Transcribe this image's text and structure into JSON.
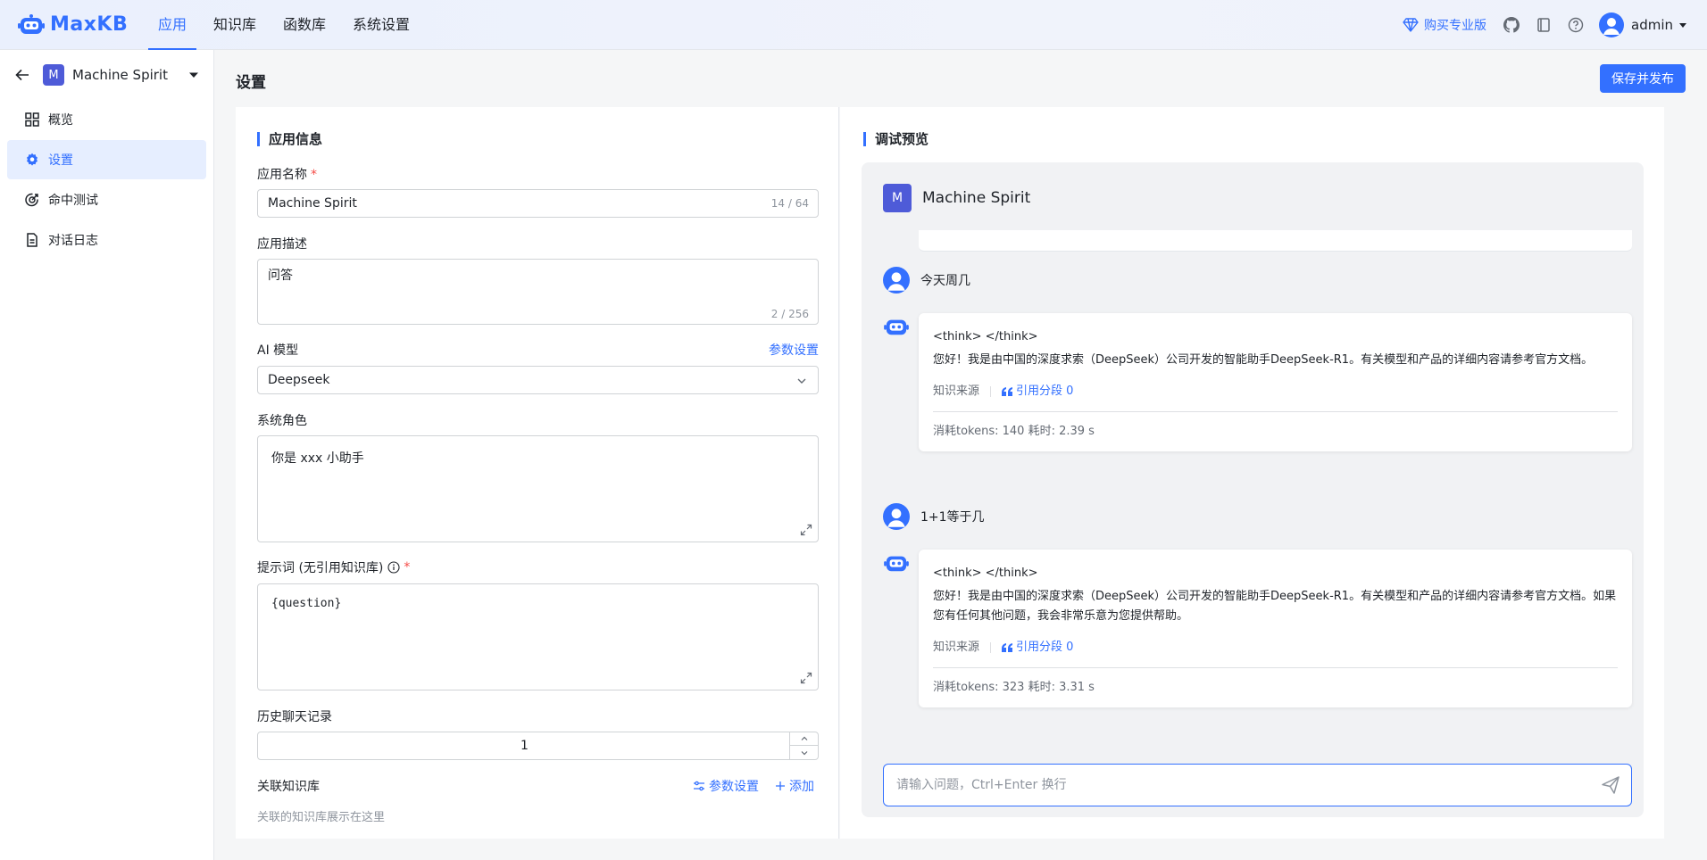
{
  "topbar": {
    "brand": "MaxKB",
    "nav": [
      "应用",
      "知识库",
      "函数库",
      "系统设置"
    ],
    "upgrade_label": "购买专业版",
    "username": "admin"
  },
  "sidebar": {
    "app_initial": "M",
    "app_name": "Machine Spirit",
    "items": [
      {
        "label": "概览",
        "icon": "grid-icon"
      },
      {
        "label": "设置",
        "icon": "gear-icon"
      },
      {
        "label": "命中测试",
        "icon": "target-icon"
      },
      {
        "label": "对话日志",
        "icon": "document-icon"
      }
    ]
  },
  "page": {
    "title": "设置",
    "publish_label": "保存并发布"
  },
  "form": {
    "section_title": "应用信息",
    "name_label": "应用名称",
    "name_value": "Machine Spirit",
    "name_count": "14 / 64",
    "desc_label": "应用描述",
    "desc_value": "问答",
    "desc_count": "2 / 256",
    "model_label": "AI 模型",
    "model_params_link": "参数设置",
    "model_value": "Deepseek",
    "role_label": "系统角色",
    "role_value": "你是 xxx 小助手",
    "prompt_label": "提示词 (无引用知识库)",
    "prompt_value": "{question}",
    "history_label": "历史聊天记录",
    "history_value": "1",
    "kb_label": "关联知识库",
    "kb_params_link": "参数设置",
    "kb_add_link": "添加",
    "kb_hint": "关联的知识库展示在这里"
  },
  "preview": {
    "section_title": "调试预览",
    "app_initial": "M",
    "app_name": "Machine Spirit",
    "messages": [
      {
        "question": "今天周几",
        "think": "<think> </think>",
        "answer": "您好！我是由中国的深度求索（DeepSeek）公司开发的智能助手DeepSeek-R1。有关模型和产品的详细内容请参考官方文档。",
        "source_label": "知识来源",
        "cite_label": "引用分段 0",
        "tokens": "消耗tokens: 140  耗时: 2.39 s"
      },
      {
        "question": "1+1等于几",
        "think": "<think> </think>",
        "answer": "您好！我是由中国的深度求索（DeepSeek）公司开发的智能助手DeepSeek-R1。有关模型和产品的详细内容请参考官方文档。如果您有任何其他问题，我会非常乐意为您提供帮助。",
        "source_label": "知识来源",
        "cite_label": "引用分段 0",
        "tokens": "消耗tokens: 323  耗时: 3.31 s"
      }
    ],
    "input_placeholder": "请输入问题，Ctrl+Enter 换行"
  }
}
